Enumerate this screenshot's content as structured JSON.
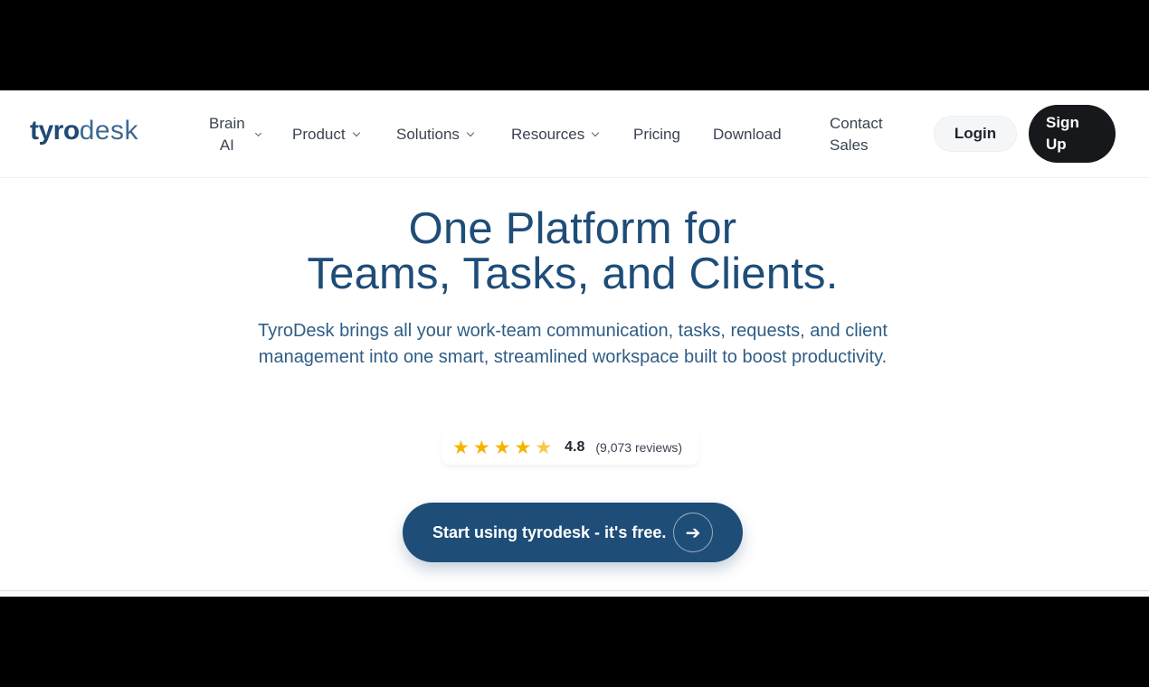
{
  "brand": {
    "logo_bold": "tyro",
    "logo_light": "desk"
  },
  "nav": {
    "brain_line1": "Brain",
    "brain_line2": "AI",
    "product": "Product",
    "solutions": "Solutions",
    "resources": "Resources",
    "pricing": "Pricing",
    "download": "Download",
    "contact_line1": "Contact",
    "contact_line2": "Sales"
  },
  "auth": {
    "login": "Login",
    "signup_line1": "Sign",
    "signup_line2": "Up"
  },
  "hero": {
    "title_line1": "One Platform for",
    "title_line2": "Teams, Tasks, and Clients.",
    "subtitle": "TyroDesk brings all your work-team communication, tasks, requests, and client management into one smart, streamlined workspace built to boost productivity."
  },
  "rating": {
    "stars": 4.5,
    "value": "4.8",
    "count": "(9,073 reviews)"
  },
  "cta": {
    "label": "Start using tyrodesk - it's free.",
    "icon": "arrow-right-icon"
  },
  "colors": {
    "brand_blue": "#1e4d78",
    "logo_dot": "#e0312d",
    "star": "#f5b400",
    "signup_bg": "#16181c"
  }
}
